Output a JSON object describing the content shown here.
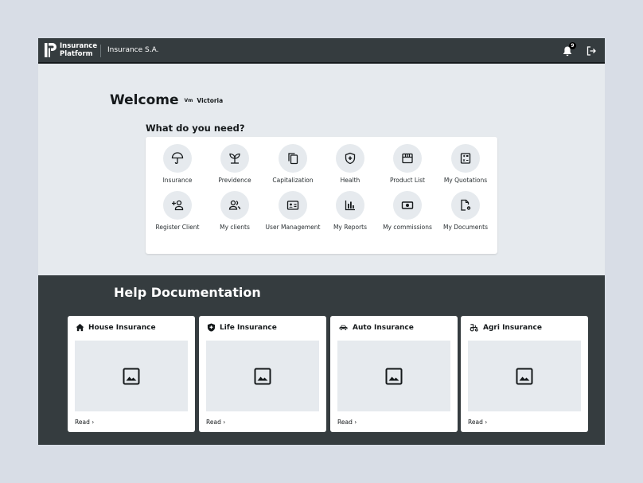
{
  "topbar": {
    "brand_line1": "Insurance",
    "brand_line2": "Platform",
    "company": "Insurance S.A.",
    "notification_count": "9",
    "icons": [
      "logo-icon",
      "bell-icon",
      "logout-icon"
    ]
  },
  "welcome": {
    "title": "Welcome",
    "salutation": "Vm",
    "name": "Victoria"
  },
  "services": {
    "heading": "What do you need?",
    "items": [
      {
        "label": "Insurance",
        "icon": "umbrella-icon"
      },
      {
        "label": "Previdence",
        "icon": "plant-icon"
      },
      {
        "label": "Capitalization",
        "icon": "copy-icon"
      },
      {
        "label": "Health",
        "icon": "shield-plus-icon"
      },
      {
        "label": "Product List",
        "icon": "store-icon"
      },
      {
        "label": "My Quotations",
        "icon": "calculator-icon"
      },
      {
        "label": "Register Client",
        "icon": "add-user-icon"
      },
      {
        "label": "My clients",
        "icon": "users-icon"
      },
      {
        "label": "User Management",
        "icon": "id-card-icon"
      },
      {
        "label": "My Reports",
        "icon": "bar-chart-icon"
      },
      {
        "label": "My commissions",
        "icon": "money-icon"
      },
      {
        "label": "My Documents",
        "icon": "document-settings-icon"
      }
    ]
  },
  "help": {
    "title": "Help Documentation",
    "read_label": "Read",
    "cards": [
      {
        "title": "House Insurance",
        "icon": "house-icon"
      },
      {
        "title": "Life Insurance",
        "icon": "shield-plus-icon"
      },
      {
        "title": "Auto Insurance",
        "icon": "car-icon"
      },
      {
        "title": "Agri Insurance",
        "icon": "tractor-icon"
      }
    ]
  },
  "colors": {
    "topbar": "#353c3f",
    "background": "#e6eaee",
    "accent_dark": "#15191b"
  }
}
